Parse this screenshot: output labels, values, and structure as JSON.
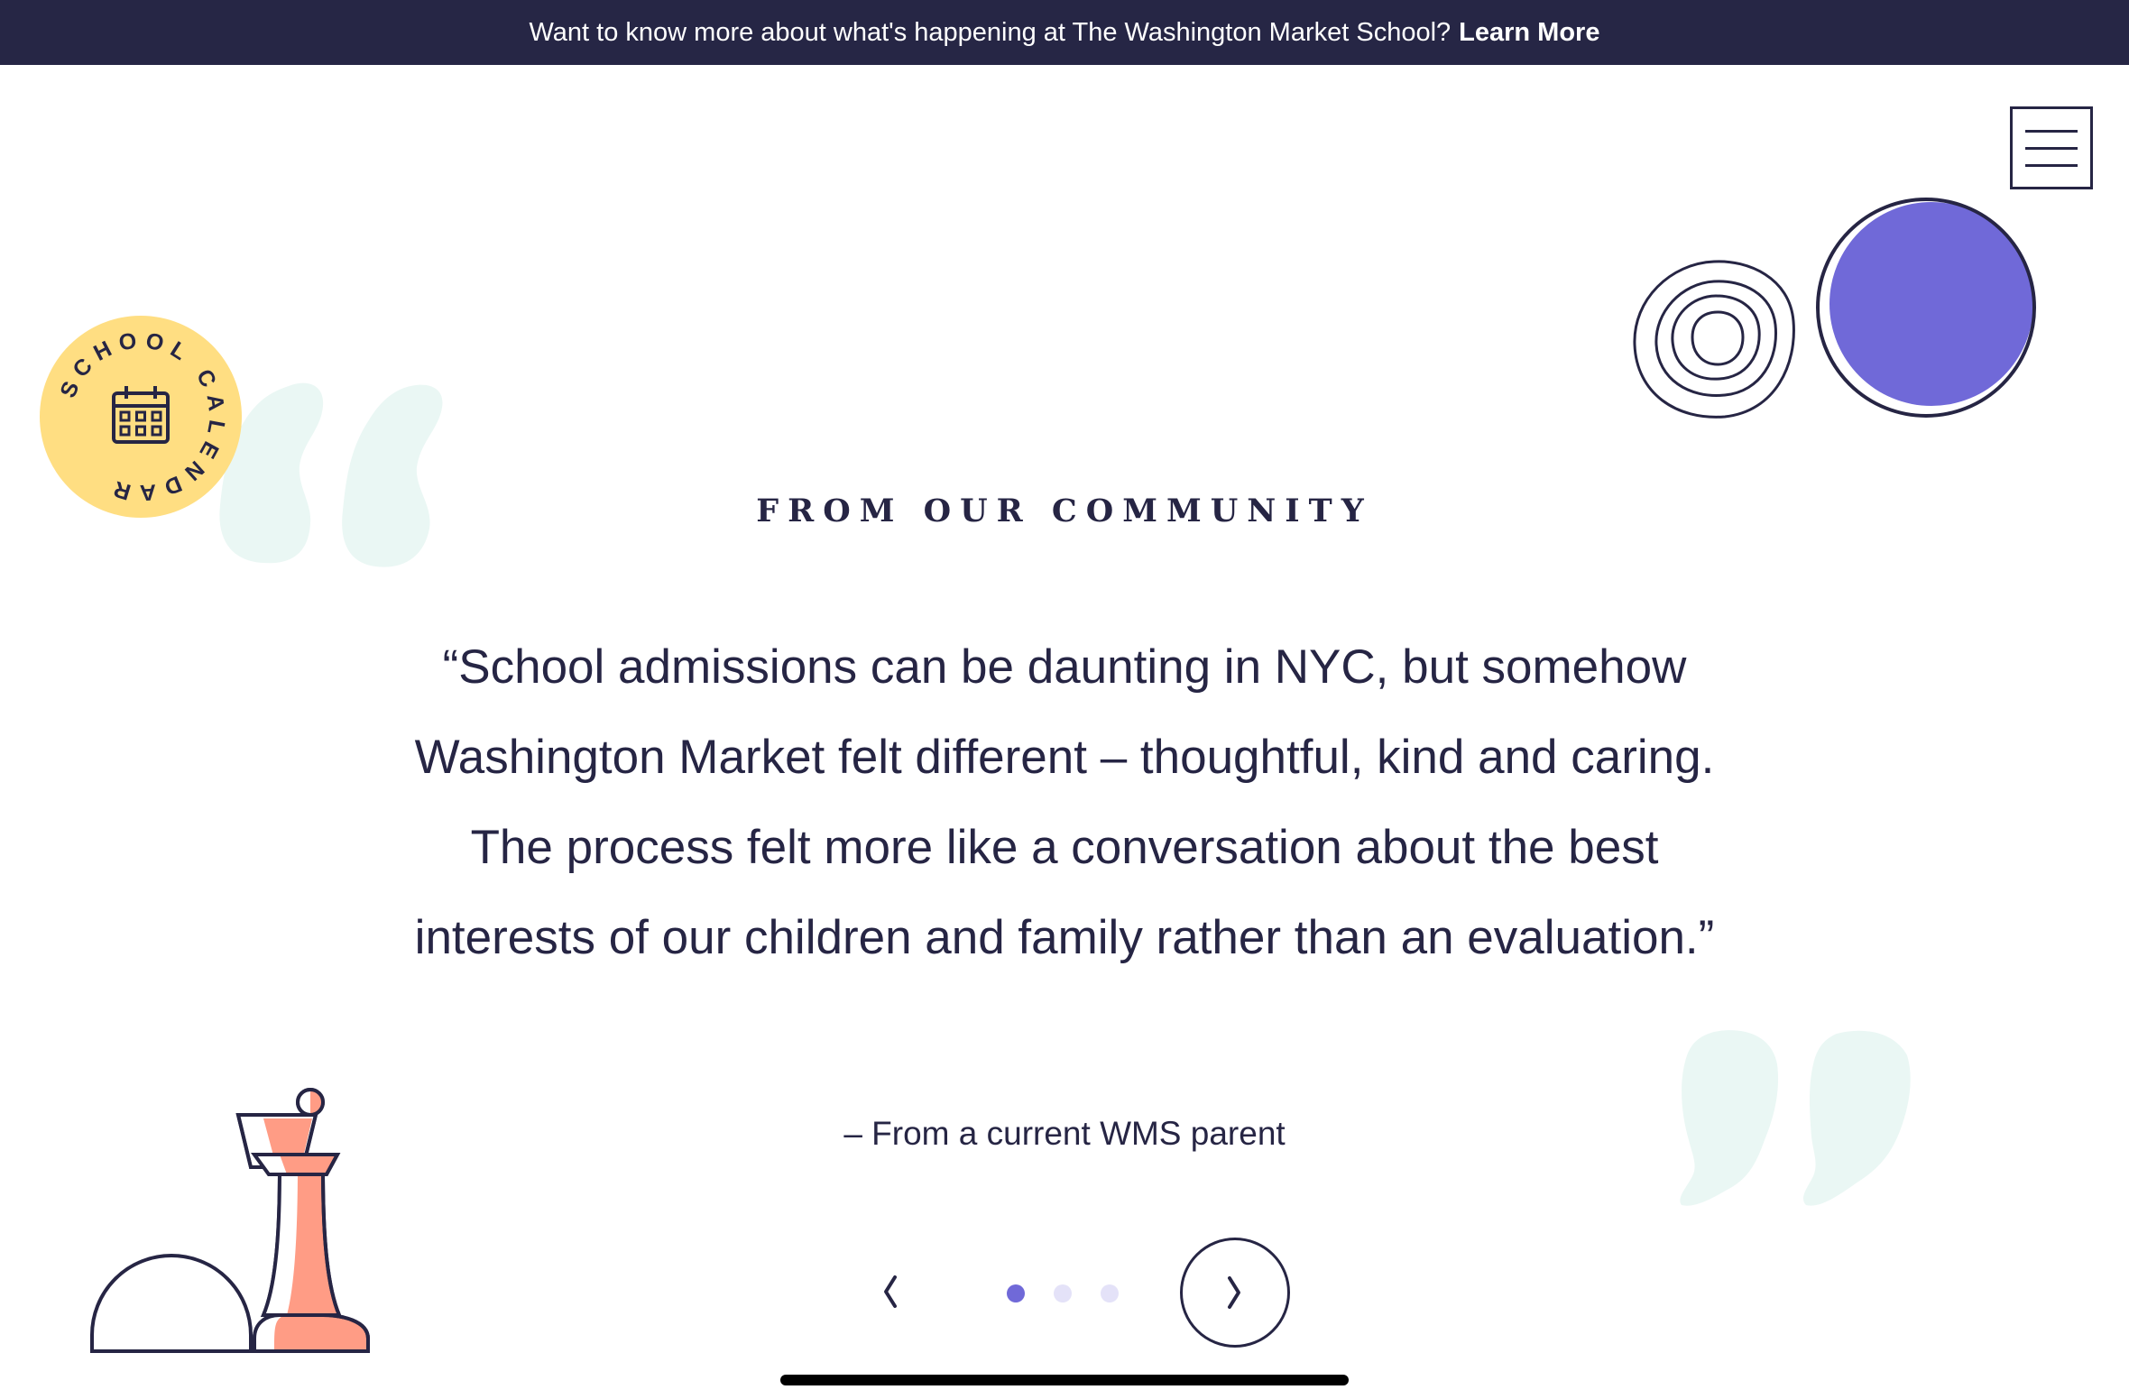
{
  "announcement": {
    "message": "Want to know more about what's happening at The Washington Market School?",
    "link_label": "Learn More"
  },
  "menu": {
    "icon": "hamburger-menu-icon"
  },
  "calendar_badge": {
    "ring_text": "SCHOOL CALENDAR",
    "icon": "calendar-icon",
    "color": "#FFDE82"
  },
  "testimonial": {
    "eyebrow": "FROM OUR COMMUNITY",
    "quote": "“School admissions can be daunting in NYC, but somehow Washington Market felt different – thoughtful, kind and caring. The process felt more like a conversation about the best interests of our children and family rather than an evaluation.”",
    "attribution": "– From a current WMS parent"
  },
  "carousel": {
    "prev_icon": "chevron-left-icon",
    "next_icon": "chevron-right-icon",
    "slide_count": 3,
    "active_index": 0
  },
  "colors": {
    "navy": "#262544",
    "purple": "#7069D8",
    "coral": "#FF9C85",
    "yellow": "#FFDE82",
    "mint": "#EAF7F4"
  }
}
